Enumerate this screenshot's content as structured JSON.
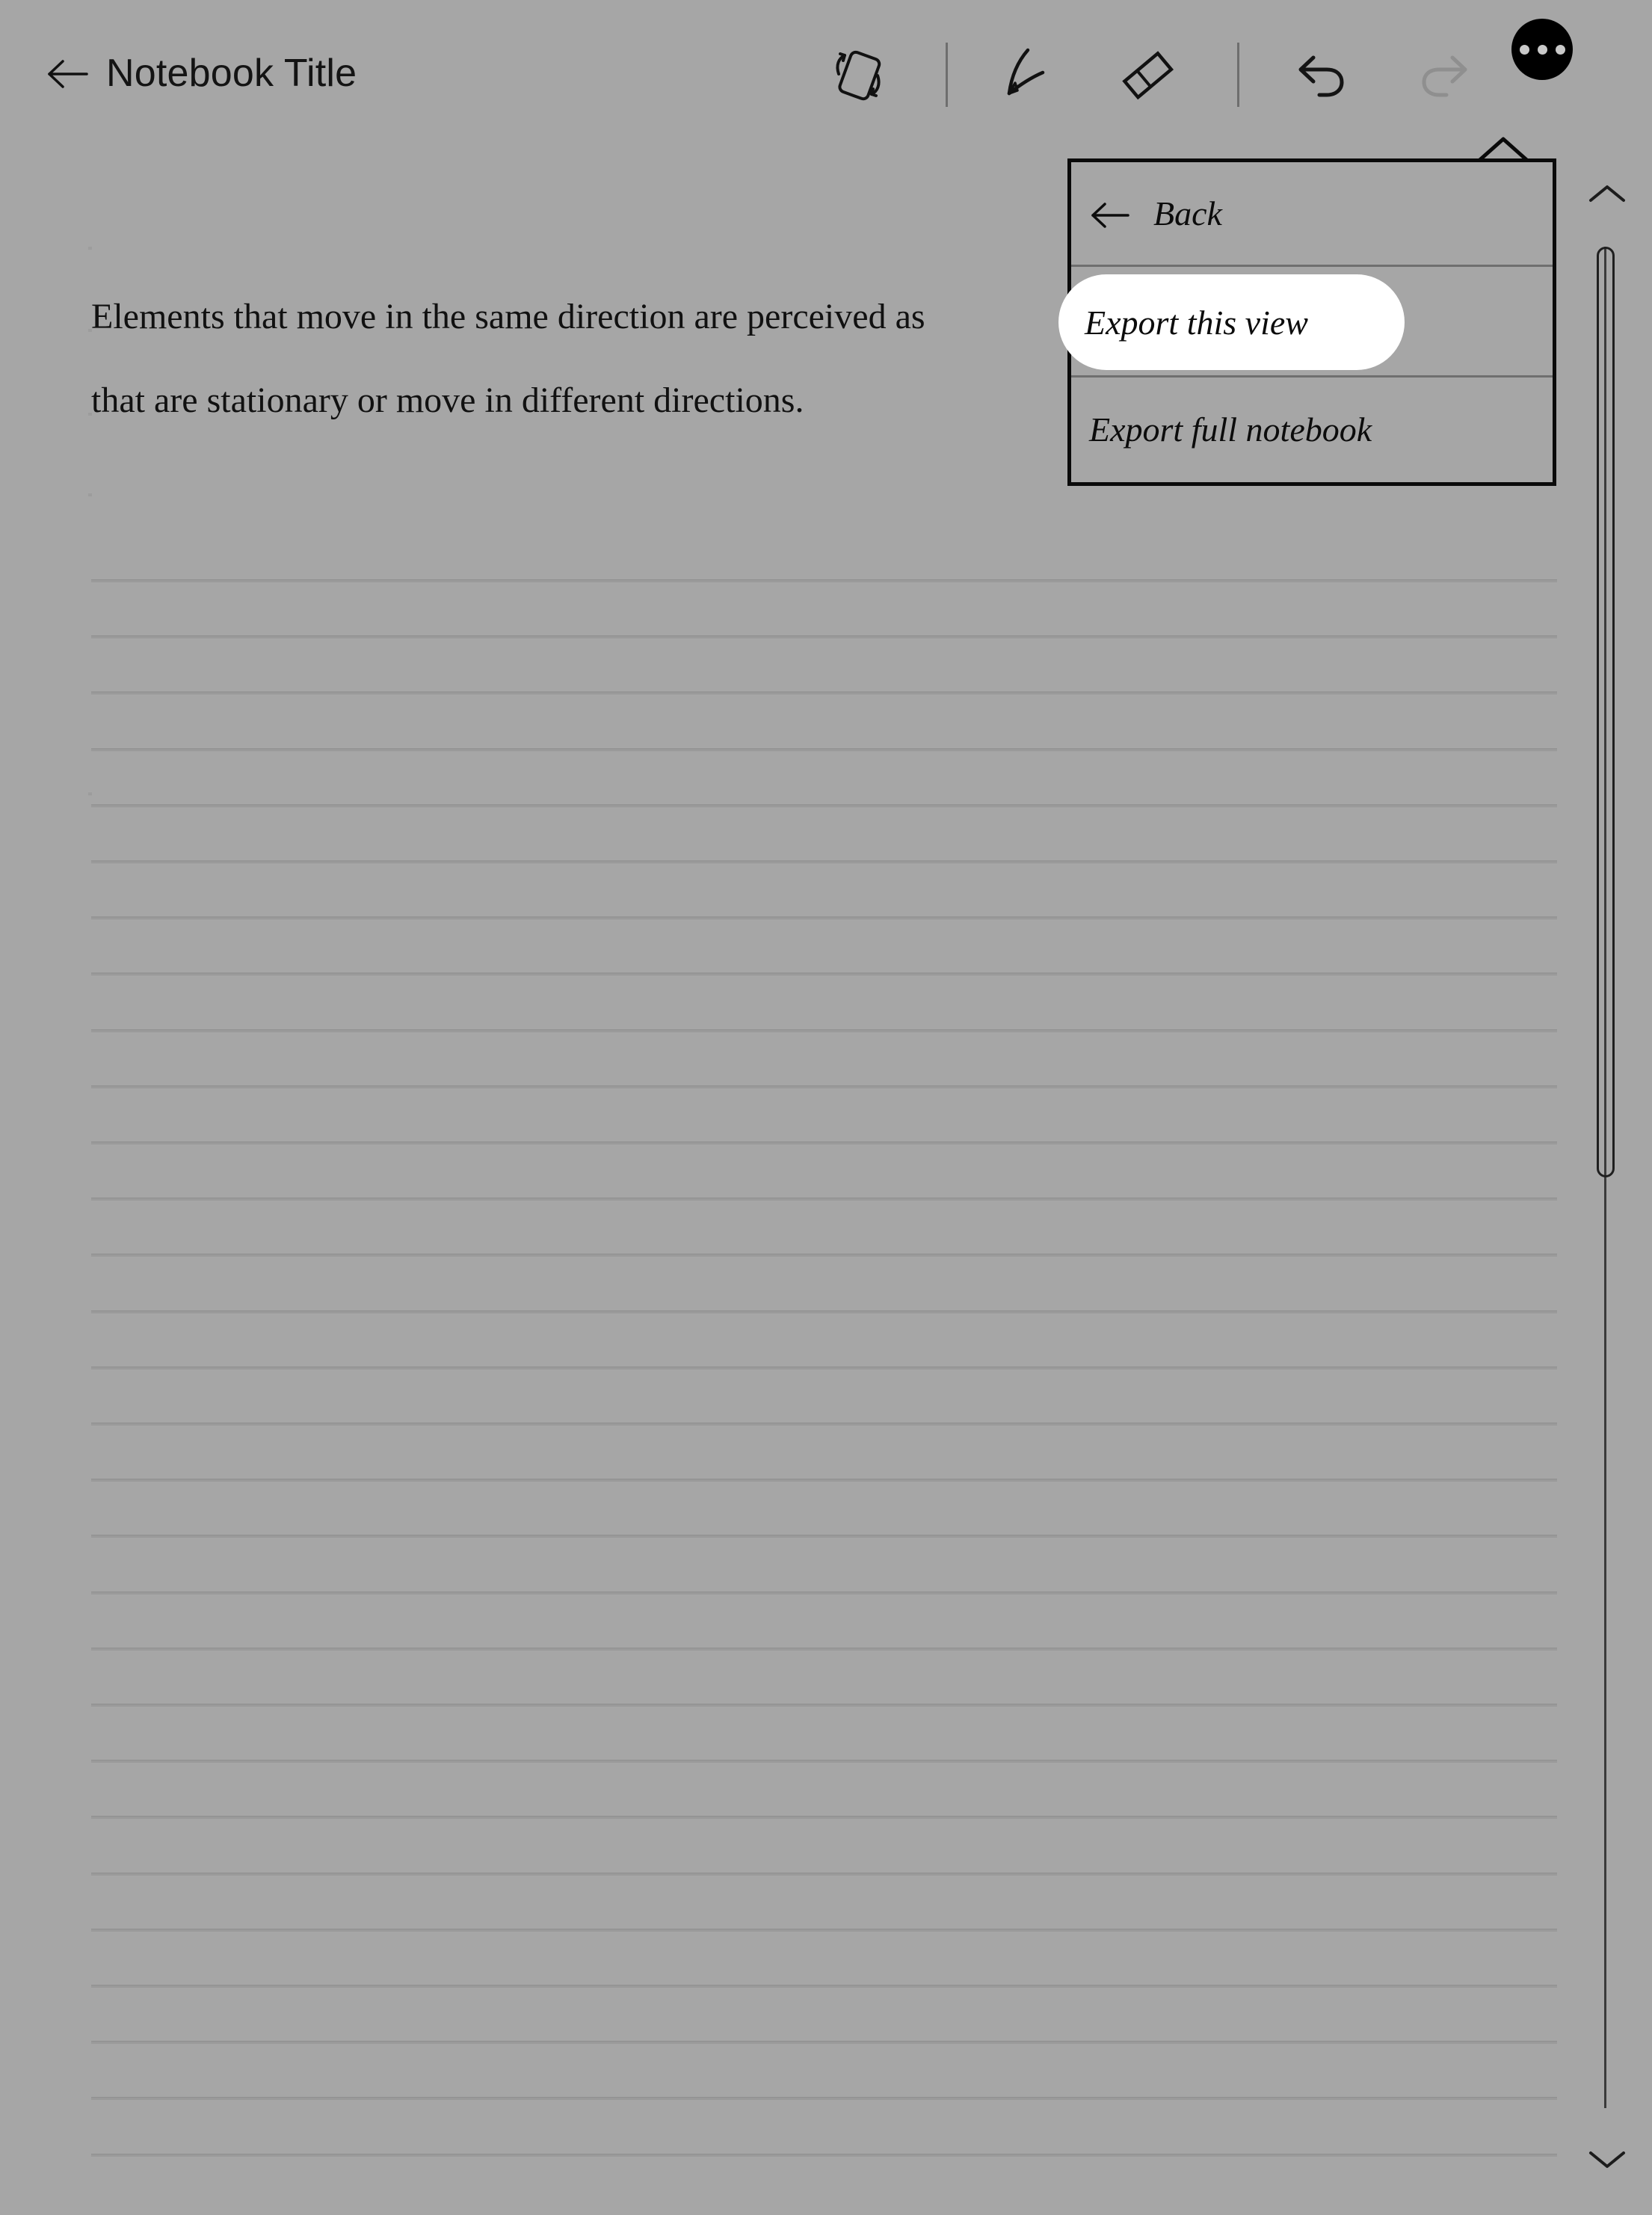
{
  "app": {
    "background_color": "#a6a6a6",
    "accent_color": "#000000"
  },
  "topbar": {
    "back_label": "Notebook Title",
    "back_icon": "arrow-left-icon",
    "tools": [
      {
        "name": "rotate-page-icon",
        "label": "Rotate page",
        "state": "enabled"
      },
      {
        "name": "pen-icon",
        "label": "Pen",
        "state": "enabled"
      },
      {
        "name": "eraser-icon",
        "label": "Eraser",
        "state": "enabled"
      },
      {
        "name": "undo-icon",
        "label": "Undo",
        "state": "enabled"
      },
      {
        "name": "redo-icon",
        "label": "Redo",
        "state": "disabled"
      }
    ],
    "more_button": {
      "name": "more-options-button",
      "icon": "ellipsis-icon",
      "state": "active"
    }
  },
  "note": {
    "lines": [
      "Elements that move in the same direction are perceived as",
      "that are stationary or move in different directions."
    ]
  },
  "menu": {
    "back": {
      "label": "Back",
      "icon": "arrow-left-icon"
    },
    "items": [
      {
        "label": "Export this view",
        "selected": true
      },
      {
        "label": "Export full notebook",
        "selected": false
      }
    ],
    "highlight_color": "#ffffff",
    "border_color": "#0a0a0a"
  },
  "scrollbar": {
    "up_icon": "chevron-up-icon",
    "down_icon": "chevron-down-icon",
    "thumb_name": "scrollbar-thumb"
  }
}
